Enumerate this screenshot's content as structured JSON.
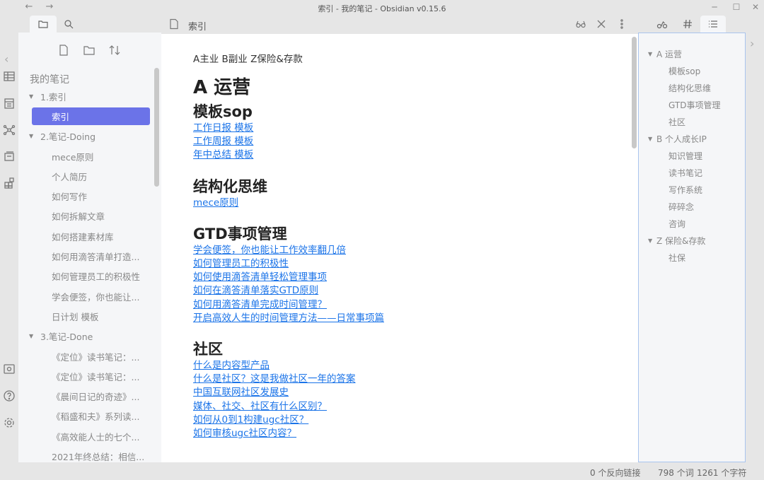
{
  "window": {
    "title": "索引 - 我的笔记 - Obsidian v0.15.6",
    "back": "←",
    "forward": "→",
    "minimize": "─",
    "maximize": "☐",
    "close": "✕"
  },
  "left_sidebar": {
    "vault_name": "我的笔记",
    "tree": [
      {
        "type": "folder",
        "label": "1.索引"
      },
      {
        "type": "file",
        "label": "索引",
        "selected": true
      },
      {
        "type": "folder",
        "label": "2.笔记-Doing"
      },
      {
        "type": "file",
        "label": "mece原则"
      },
      {
        "type": "file",
        "label": "个人简历"
      },
      {
        "type": "file",
        "label": "如何写作"
      },
      {
        "type": "file",
        "label": "如何拆解文章"
      },
      {
        "type": "file",
        "label": "如何搭建素材库"
      },
      {
        "type": "file",
        "label": "如何用滴答清单打造..."
      },
      {
        "type": "file",
        "label": "如何管理员工的积极性"
      },
      {
        "type": "file",
        "label": "学会便签，你也能让..."
      },
      {
        "type": "file",
        "label": "日计划 模板"
      },
      {
        "type": "folder",
        "label": "3.笔记-Done"
      },
      {
        "type": "file",
        "label": "《定位》读书笔记：..."
      },
      {
        "type": "file",
        "label": "《定位》读书笔记：..."
      },
      {
        "type": "file",
        "label": "《晨间日记的奇迹》..."
      },
      {
        "type": "file",
        "label": "《稻盛和夫》系列读..."
      },
      {
        "type": "file",
        "label": "《高效能人士的七个..."
      },
      {
        "type": "file",
        "label": "2021年终总结：相信..."
      }
    ]
  },
  "editor": {
    "tab_title": "索引",
    "lead": "A主业 B副业 Z保险&存款",
    "h1": "A 运营",
    "sections": [
      {
        "heading": "模板sop",
        "links": [
          "工作日报 模板",
          "工作周报 模板",
          "年中总结 模板"
        ]
      },
      {
        "heading": "结构化思维",
        "links": [
          "mece原则"
        ]
      },
      {
        "heading": "GTD事项管理",
        "links": [
          "学会便签，你也能让工作效率翻几倍",
          "如何管理员工的积极性",
          "如何使用滴答清单轻松管理事项",
          "如何在滴答清单落实GTD原则",
          "如何用滴答清单完成时间管理？",
          "开启高效人生的时间管理方法——日常事项篇"
        ]
      },
      {
        "heading": "社区",
        "links": [
          "什么是内容型产品",
          "什么是社区？这是我做社区一年的答案",
          "中国互联网社区发展史",
          "媒体、社交、社区有什么区别？",
          "如何从0到1构建ugc社区？",
          "如何审核ugc社区内容？"
        ]
      }
    ]
  },
  "outline": [
    {
      "level": 1,
      "label": "A 运营"
    },
    {
      "level": 2,
      "label": "模板sop"
    },
    {
      "level": 2,
      "label": "结构化思维"
    },
    {
      "level": 2,
      "label": "GTD事项管理"
    },
    {
      "level": 2,
      "label": "社区"
    },
    {
      "level": 1,
      "label": "B 个人成长IP"
    },
    {
      "level": 2,
      "label": "知识管理"
    },
    {
      "level": 2,
      "label": "读书笔记"
    },
    {
      "level": 2,
      "label": "写作系统"
    },
    {
      "level": 2,
      "label": "碎碎念"
    },
    {
      "level": 2,
      "label": "咨询"
    },
    {
      "level": 1,
      "label": "Z 保险&存款"
    },
    {
      "level": 2,
      "label": "社保"
    }
  ],
  "status": {
    "backlinks": "0 个反向链接",
    "words": "798 个词",
    "chars": "1261 个字符"
  },
  "colors": {
    "accent": "#6b73e8",
    "link": "#1a73e8"
  }
}
